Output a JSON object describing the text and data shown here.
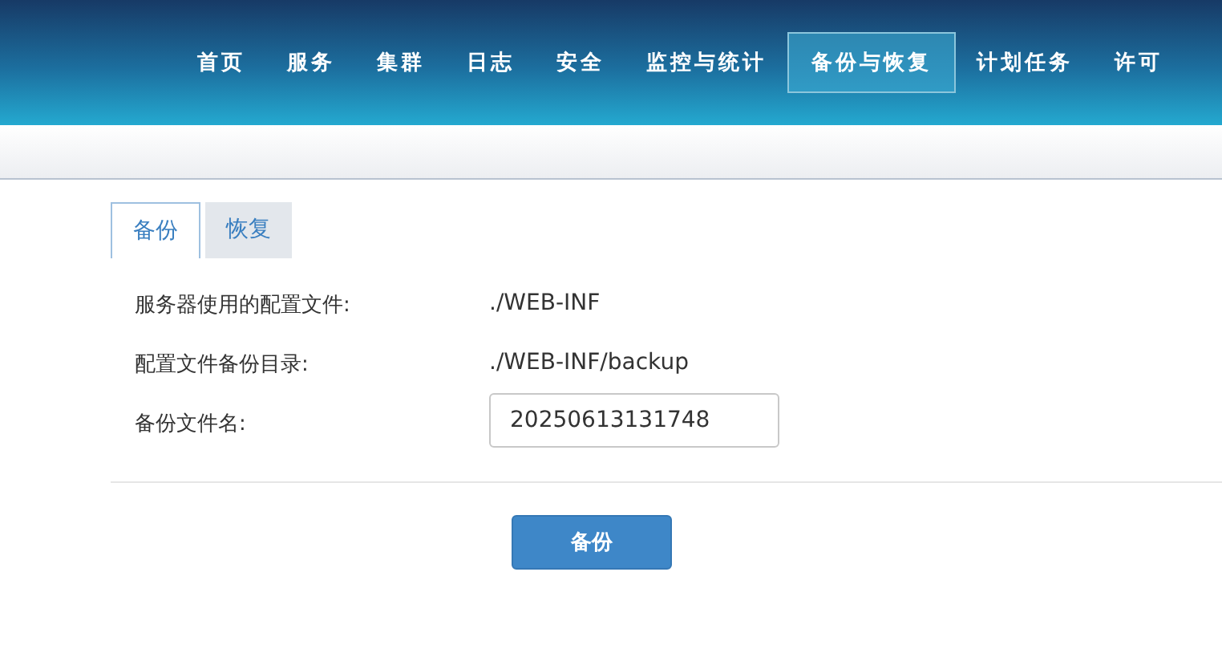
{
  "nav": [
    {
      "label": "首页",
      "selected": false
    },
    {
      "label": "服务",
      "selected": false
    },
    {
      "label": "集群",
      "selected": false
    },
    {
      "label": "日志",
      "selected": false
    },
    {
      "label": "安全",
      "selected": false
    },
    {
      "label": "监控与统计",
      "selected": false
    },
    {
      "label": "备份与恢复",
      "selected": true
    },
    {
      "label": "计划任务",
      "selected": false
    },
    {
      "label": "许可",
      "selected": false
    }
  ],
  "tabs": [
    {
      "label": "备份",
      "selected": true
    },
    {
      "label": "恢复",
      "selected": false
    }
  ],
  "form": [
    {
      "kind": "text",
      "label": "服务器使用的配置文件:",
      "value": "./WEB-INF"
    },
    {
      "kind": "text",
      "label": "配置文件备份目录:",
      "value": "./WEB-INF/backup"
    },
    {
      "kind": "input",
      "label": "备份文件名:",
      "value": "20250613131748"
    }
  ],
  "button": "备份"
}
